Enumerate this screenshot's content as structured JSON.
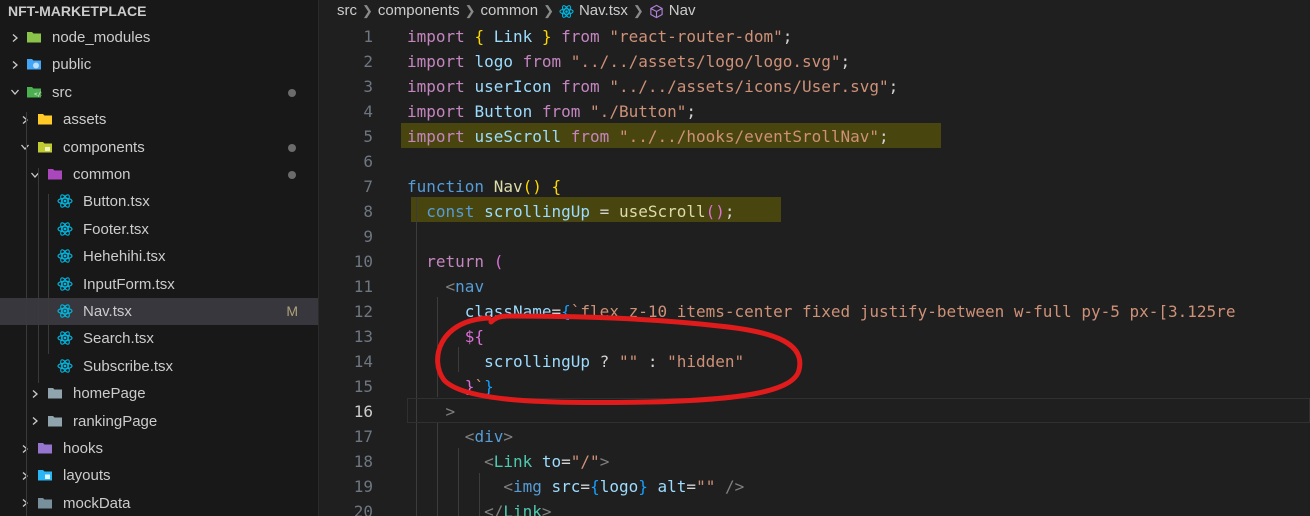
{
  "explorer": {
    "title": "NFT-MARKETPLACE",
    "items": [
      {
        "label": "node_modules",
        "icon": "node-folder-icon",
        "expanded": false,
        "level": 0
      },
      {
        "label": "public",
        "icon": "public-folder-icon",
        "expanded": false,
        "level": 0
      },
      {
        "label": "src",
        "icon": "src-folder-icon",
        "expanded": true,
        "level": 0,
        "modified_dot": true
      },
      {
        "label": "assets",
        "icon": "assets-folder-icon",
        "expanded": false,
        "level": 1
      },
      {
        "label": "components",
        "icon": "components-folder-icon",
        "expanded": true,
        "level": 1,
        "modified_dot": true
      },
      {
        "label": "common",
        "icon": "common-folder-icon",
        "expanded": true,
        "level": 2,
        "modified_dot": true
      },
      {
        "label": "Button.tsx",
        "icon": "react-file-icon",
        "level": 3
      },
      {
        "label": "Footer.tsx",
        "icon": "react-file-icon",
        "level": 3
      },
      {
        "label": "Hehehihi.tsx",
        "icon": "react-file-icon",
        "level": 3
      },
      {
        "label": "InputForm.tsx",
        "icon": "react-file-icon",
        "level": 3
      },
      {
        "label": "Nav.tsx",
        "icon": "react-file-icon",
        "level": 3,
        "selected": true,
        "badge": "M"
      },
      {
        "label": "Search.tsx",
        "icon": "react-file-icon",
        "level": 3
      },
      {
        "label": "Subscribe.tsx",
        "icon": "react-file-icon",
        "level": 3
      },
      {
        "label": "homePage",
        "icon": "folder-icon",
        "expanded": false,
        "level": 2
      },
      {
        "label": "rankingPage",
        "icon": "folder-icon",
        "expanded": false,
        "level": 2
      },
      {
        "label": "hooks",
        "icon": "hooks-folder-icon",
        "expanded": false,
        "level": 1
      },
      {
        "label": "layouts",
        "icon": "layouts-folder-icon",
        "expanded": false,
        "level": 1
      },
      {
        "label": "mockData",
        "icon": "mockdata-folder-icon",
        "expanded": false,
        "level": 1
      }
    ]
  },
  "breadcrumb": {
    "items": [
      "src",
      "components",
      "common",
      "Nav.tsx",
      "Nav"
    ]
  },
  "editor": {
    "active_line": 16,
    "lines": [
      {
        "n": "1",
        "tokens": [
          {
            "t": "import",
            "c": "k"
          },
          {
            "t": " "
          },
          {
            "t": "{",
            "c": "b1"
          },
          {
            "t": " Link ",
            "c": "v"
          },
          {
            "t": "}",
            "c": "b1"
          },
          {
            "t": " "
          },
          {
            "t": "from",
            "c": "k"
          },
          {
            "t": " "
          },
          {
            "t": "\"react-router-dom\"",
            "c": "s"
          },
          {
            "t": ";"
          }
        ]
      },
      {
        "n": "2",
        "tokens": [
          {
            "t": "import",
            "c": "k"
          },
          {
            "t": " "
          },
          {
            "t": "logo",
            "c": "v"
          },
          {
            "t": " "
          },
          {
            "t": "from",
            "c": "k"
          },
          {
            "t": " "
          },
          {
            "t": "\"../../assets/logo/logo.svg\"",
            "c": "s"
          },
          {
            "t": ";"
          }
        ]
      },
      {
        "n": "3",
        "tokens": [
          {
            "t": "import",
            "c": "k"
          },
          {
            "t": " "
          },
          {
            "t": "userIcon",
            "c": "v"
          },
          {
            "t": " "
          },
          {
            "t": "from",
            "c": "k"
          },
          {
            "t": " "
          },
          {
            "t": "\"../../assets/icons/User.svg\"",
            "c": "s"
          },
          {
            "t": ";"
          }
        ]
      },
      {
        "n": "4",
        "tokens": [
          {
            "t": "import",
            "c": "k"
          },
          {
            "t": " "
          },
          {
            "t": "Button",
            "c": "v"
          },
          {
            "t": " "
          },
          {
            "t": "from",
            "c": "k"
          },
          {
            "t": " "
          },
          {
            "t": "\"./Button\"",
            "c": "s"
          },
          {
            "t": ";"
          }
        ]
      },
      {
        "n": "5",
        "tokens": [
          {
            "t": "import",
            "c": "k"
          },
          {
            "t": " "
          },
          {
            "t": "useScroll",
            "c": "v"
          },
          {
            "t": " "
          },
          {
            "t": "from",
            "c": "k"
          },
          {
            "t": " "
          },
          {
            "t": "\"../../hooks/eventSrollNav\"",
            "c": "s"
          },
          {
            "t": ";"
          }
        ]
      },
      {
        "n": "6",
        "tokens": []
      },
      {
        "n": "7",
        "tokens": [
          {
            "t": "function",
            "c": "kw"
          },
          {
            "t": " "
          },
          {
            "t": "Nav",
            "c": "fn"
          },
          {
            "t": "()",
            "c": "b1"
          },
          {
            "t": " "
          },
          {
            "t": "{",
            "c": "b1"
          }
        ]
      },
      {
        "n": "8",
        "tokens": [
          {
            "t": "  "
          },
          {
            "t": "const",
            "c": "kw"
          },
          {
            "t": " "
          },
          {
            "t": "scrollingUp",
            "c": "v"
          },
          {
            "t": " = "
          },
          {
            "t": "useScroll",
            "c": "fn"
          },
          {
            "t": "()",
            "c": "b2"
          },
          {
            "t": ";"
          }
        ]
      },
      {
        "n": "9",
        "tokens": []
      },
      {
        "n": "10",
        "tokens": [
          {
            "t": "  "
          },
          {
            "t": "return",
            "c": "k"
          },
          {
            "t": " "
          },
          {
            "t": "(",
            "c": "b2"
          }
        ]
      },
      {
        "n": "11",
        "tokens": [
          {
            "t": "    "
          },
          {
            "t": "<",
            "c": "tg"
          },
          {
            "t": "nav",
            "c": "tag"
          }
        ]
      },
      {
        "n": "12",
        "tokens": [
          {
            "t": "      "
          },
          {
            "t": "className",
            "c": "v"
          },
          {
            "t": "="
          },
          {
            "t": "{",
            "c": "b3"
          },
          {
            "t": "`flex z-10 items-center fixed justify-between w-full py-5 px-[3.125re",
            "c": "s"
          }
        ]
      },
      {
        "n": "13",
        "tokens": [
          {
            "t": "      "
          },
          {
            "t": "${",
            "c": "b2"
          }
        ]
      },
      {
        "n": "14",
        "tokens": [
          {
            "t": "        "
          },
          {
            "t": "scrollingUp",
            "c": "v"
          },
          {
            "t": " ? "
          },
          {
            "t": "\"\"",
            "c": "s"
          },
          {
            "t": " : "
          },
          {
            "t": "\"hidden\"",
            "c": "s"
          }
        ]
      },
      {
        "n": "15",
        "tokens": [
          {
            "t": "      "
          },
          {
            "t": "}",
            "c": "b2"
          },
          {
            "t": "`",
            "c": "s"
          },
          {
            "t": "}",
            "c": "b3"
          }
        ]
      },
      {
        "n": "16",
        "tokens": [
          {
            "t": "    "
          },
          {
            "t": ">",
            "c": "tg"
          }
        ]
      },
      {
        "n": "17",
        "tokens": [
          {
            "t": "      "
          },
          {
            "t": "<",
            "c": "tg"
          },
          {
            "t": "div",
            "c": "tag"
          },
          {
            "t": ">",
            "c": "tg"
          }
        ]
      },
      {
        "n": "18",
        "tokens": [
          {
            "t": "        "
          },
          {
            "t": "<",
            "c": "tg"
          },
          {
            "t": "Link",
            "c": "cmp"
          },
          {
            "t": " "
          },
          {
            "t": "to",
            "c": "v"
          },
          {
            "t": "="
          },
          {
            "t": "\"/\"",
            "c": "s"
          },
          {
            "t": ">",
            "c": "tg"
          }
        ]
      },
      {
        "n": "19",
        "tokens": [
          {
            "t": "          "
          },
          {
            "t": "<",
            "c": "tg"
          },
          {
            "t": "img",
            "c": "tag"
          },
          {
            "t": " "
          },
          {
            "t": "src",
            "c": "v"
          },
          {
            "t": "="
          },
          {
            "t": "{",
            "c": "b3"
          },
          {
            "t": "logo",
            "c": "v"
          },
          {
            "t": "}",
            "c": "b3"
          },
          {
            "t": " "
          },
          {
            "t": "alt",
            "c": "v"
          },
          {
            "t": "="
          },
          {
            "t": "\"\"",
            "c": "s"
          },
          {
            "t": " "
          },
          {
            "t": "/>",
            "c": "tg"
          }
        ]
      },
      {
        "n": "20",
        "tokens": [
          {
            "t": "        "
          },
          {
            "t": "</",
            "c": "tg"
          },
          {
            "t": "Link",
            "c": "cmp"
          },
          {
            "t": ">",
            "c": "tg"
          }
        ]
      }
    ]
  },
  "colors": {
    "annotation_red": "#e01b1b",
    "highlight": "#5f5a00",
    "selection_bg": "#37373d"
  }
}
